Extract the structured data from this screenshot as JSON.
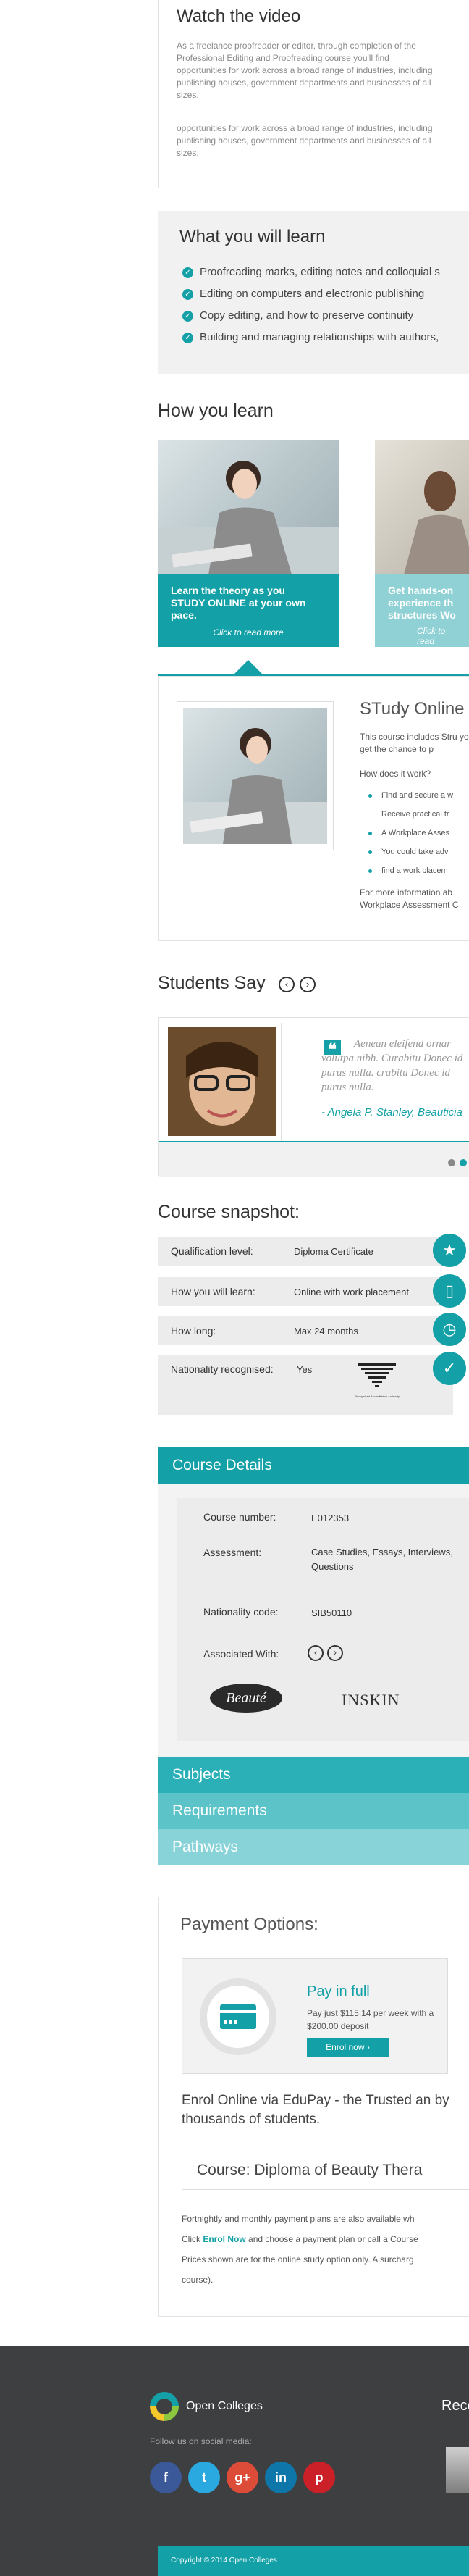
{
  "video": {
    "title": "Watch the video",
    "para1": "As a freelance proofreader or editor, through completion of the Professional Editing and Proofreading course you'll find opportunities for work across a broad range of industries, including publishing houses, government departments and businesses of all sizes.",
    "para2": "opportunities for work across a broad range of industries, including publishing houses, government departments and businesses of all sizes."
  },
  "learn": {
    "title": "What you will learn",
    "items": [
      "Proofreading marks, editing notes and colloquial s",
      "Editing on computers and electronic publishing",
      "Copy editing, and how to preserve continuity",
      "Building and managing relationships with authors,"
    ]
  },
  "how": {
    "title": "How you learn",
    "card1": {
      "title": "Learn the theory as you STUDY ONLINE at your own pace.",
      "link": "Click to read more"
    },
    "card2": {
      "title": "Get hands-on experience th structures Wo",
      "link": "Click to read"
    },
    "detail": {
      "title": "STudy Online",
      "intro": "This course includes Stru you'll get the chance to p",
      "question": "How does it work?",
      "bullets": [
        "Find and secure a w",
        "Receive practical tr",
        "A Workplace Asses",
        "You could take adv",
        "find a work placem"
      ],
      "footer": "For more information ab Workplace Assessment C"
    }
  },
  "students": {
    "title": "Students Say",
    "prev": "‹",
    "next": "›",
    "quote": "Aenean eleifend ornar volutpa nibh. Curabitu Donec id purus nulla. crabitu Donec id purus nulla.",
    "author": "- Angela P. Stanley, Beauticia"
  },
  "snapshot": {
    "title": "Course snapshot:",
    "rows": [
      {
        "label": "Qualification level:",
        "value": "Diploma Certificate",
        "icon": "★"
      },
      {
        "label": "How you will learn:",
        "value": "Online with work placement",
        "icon": "▯"
      },
      {
        "label": "How long:",
        "value": "Max 24 months",
        "icon": "◷"
      },
      {
        "label": "Nationality recognised:",
        "value": "Yes",
        "icon": "✓"
      }
    ],
    "logo_caption": "Recognised Accreditation Authority"
  },
  "details": {
    "title": "Course Details",
    "course_number_label": "Course number:",
    "course_number": "E012353",
    "assessment_label": "Assessment:",
    "assessment": "Case Studies, Essays, Interviews, Questions",
    "national_label": "Nationality code:",
    "national_code": "SIB50110",
    "associated_label": "Associated With:",
    "logo1": "Beauté",
    "logo2": "INSKIN"
  },
  "accordion": [
    "Subjects",
    "Requirements",
    "Pathways"
  ],
  "payment": {
    "title": "Payment Options:",
    "card_title": "Pay in full",
    "card_text": "Pay just $115.14 per week with a $200.00 deposit",
    "enrol_btn": "Enrol now  ›",
    "edupay": "Enrol Online via EduPay - the Trusted an by thousands of students.",
    "course_label": "Course: Diploma of Beauty Thera",
    "notes1": "Fortnightly and monthly payment plans are also available wh",
    "notes2a": "Click",
    "notes2b": "Enrol Now",
    "notes2c": "and choose a payment plan or call a Course",
    "notes3": "Prices shown are for the online study option only. A surcharg",
    "notes4": "course)."
  },
  "footer": {
    "brand": "Open Colleges",
    "follow": "Follow us on social media:",
    "recent": "Rece",
    "copyright": "Copyright © 2014 Open Colleges",
    "social": [
      {
        "name": "facebook",
        "glyph": "f",
        "color": "#3b5998"
      },
      {
        "name": "twitter",
        "glyph": "t",
        "color": "#2aa9e0"
      },
      {
        "name": "google-plus",
        "glyph": "g+",
        "color": "#dd4b39"
      },
      {
        "name": "linkedin",
        "glyph": "in",
        "color": "#0e76a8"
      },
      {
        "name": "pinterest",
        "glyph": "p",
        "color": "#cb2027"
      }
    ]
  },
  "colors": {
    "accent": "#13a0a7",
    "footer_bg": "#3e3f41",
    "copyright_bar": "#13a0a7"
  }
}
